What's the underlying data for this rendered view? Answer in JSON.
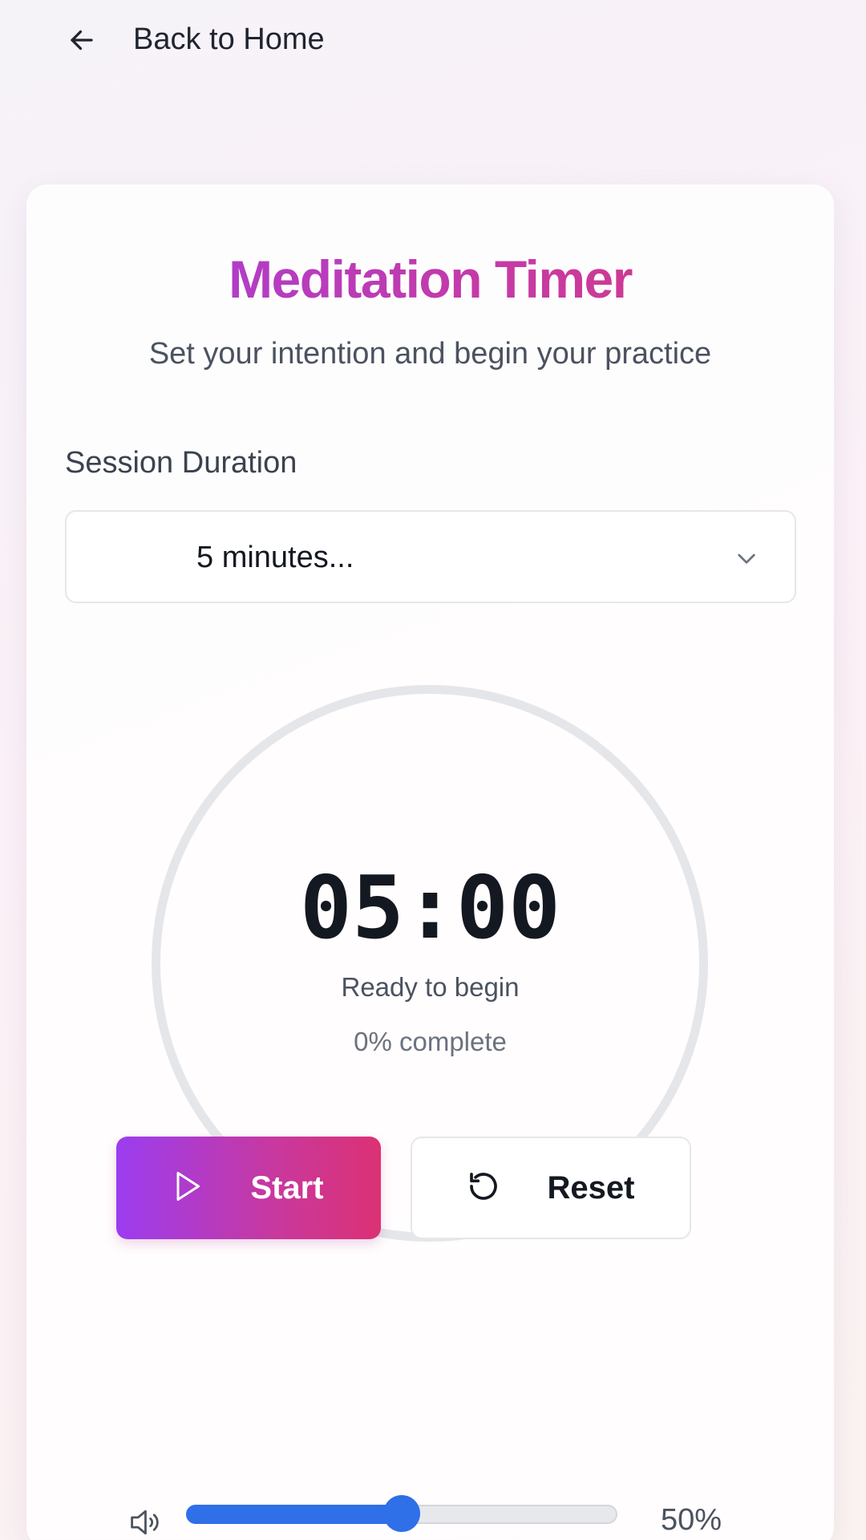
{
  "nav": {
    "back_label": "Back to Home"
  },
  "header": {
    "title": "Meditation Timer",
    "subtitle": "Set your intention and begin your practice"
  },
  "duration": {
    "label": "Session Duration",
    "selected": "5 minutes..."
  },
  "timer": {
    "time": "05:00",
    "status": "Ready to begin",
    "progress_text": "0% complete",
    "progress": 0
  },
  "controls": {
    "start_label": "Start",
    "reset_label": "Reset"
  },
  "volume": {
    "value": 50,
    "value_text": "50%"
  },
  "icons": {
    "back": "arrow-left-icon",
    "select": "chevron-down-icon",
    "start": "play-icon",
    "reset": "rotate-ccw-icon",
    "volume": "volume-icon"
  },
  "colors": {
    "accent_start": "#9b3df0",
    "accent_end": "#dc3174",
    "slider": "#2f6fe8",
    "ring": "#e5e6ea"
  }
}
